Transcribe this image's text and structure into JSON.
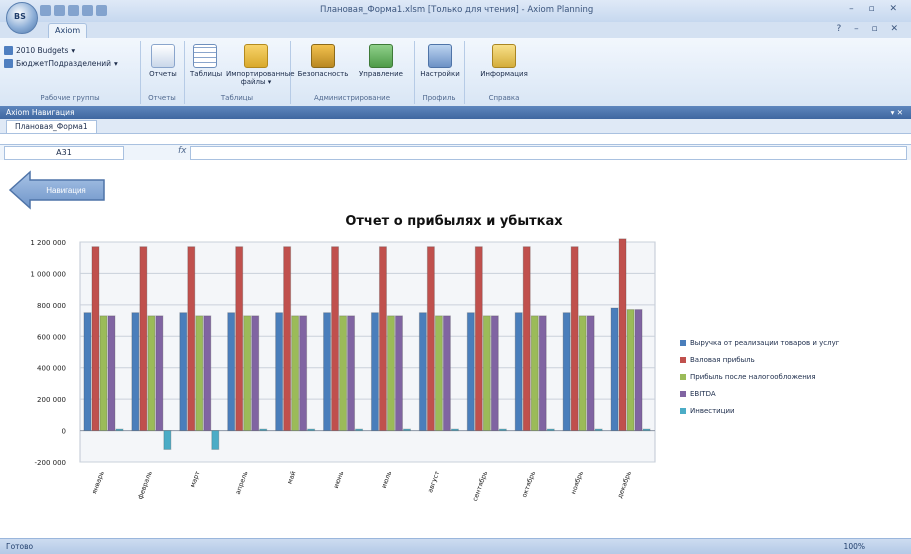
{
  "app": {
    "window_title": "Плановая_Форма1.xlsm [Только для чтения] - Axiom Planning",
    "orb_label": "BS",
    "active_tab": "Axiom"
  },
  "ribbon": {
    "groups": [
      {
        "label": "Рабочие группы",
        "items": [
          "2010 Budgets",
          "БюджетПодразделений"
        ]
      },
      {
        "label": "Отчеты",
        "buttons": [
          "Отчеты"
        ]
      },
      {
        "label": "Таблицы",
        "buttons": [
          "Таблицы",
          "Импортированные файлы"
        ]
      },
      {
        "label": "Администрирование",
        "buttons": [
          "Безопасность",
          "Управление"
        ]
      },
      {
        "label": "Профиль",
        "buttons": [
          "Настройки"
        ]
      },
      {
        "label": "Справка",
        "buttons": [
          "Информация"
        ]
      }
    ]
  },
  "nav": {
    "title": "Axiom Навигация",
    "sheet_tab": "Плановая_Форма1"
  },
  "formula": {
    "name_box": "A31",
    "fx": "fx"
  },
  "sheet": {
    "back_button_label": "Навигация"
  },
  "status": {
    "ready": "Готово",
    "zoom": "100%"
  },
  "colors": {
    "series1": "#4a7ebb",
    "series2": "#c0504d",
    "series3": "#9bbb59",
    "series4": "#8064a2",
    "series5": "#4bacc6"
  },
  "chart_data": {
    "type": "bar",
    "title": "Отчет о прибылях и убытках",
    "categories": [
      "январь",
      "февраль",
      "март",
      "апрель",
      "май",
      "июнь",
      "июль",
      "август",
      "сентябрь",
      "октябрь",
      "ноябрь",
      "декабрь"
    ],
    "ylim": [
      -200000,
      1200000
    ],
    "yticks": [
      -200000,
      0,
      200000,
      400000,
      600000,
      800000,
      1000000,
      1200000
    ],
    "ytick_labels": [
      "-200 000",
      "0",
      "200 000",
      "400 000",
      "600 000",
      "800 000",
      "1 000 000",
      "1 200 000"
    ],
    "grid": true,
    "legend_position": "right",
    "series": [
      {
        "name": "Выручка от реализации товаров и услуг",
        "values": [
          750000,
          750000,
          750000,
          750000,
          750000,
          750000,
          750000,
          750000,
          750000,
          750000,
          750000,
          780000
        ]
      },
      {
        "name": "Валовая прибыль",
        "values": [
          1170000,
          1170000,
          1170000,
          1170000,
          1170000,
          1170000,
          1170000,
          1170000,
          1170000,
          1170000,
          1170000,
          1220000
        ]
      },
      {
        "name": "Прибыль после налогообложения",
        "values": [
          730000,
          730000,
          730000,
          730000,
          730000,
          730000,
          730000,
          730000,
          730000,
          730000,
          730000,
          770000
        ]
      },
      {
        "name": "EBITDA",
        "values": [
          730000,
          730000,
          730000,
          730000,
          730000,
          730000,
          730000,
          730000,
          730000,
          730000,
          730000,
          770000
        ]
      },
      {
        "name": "Инвестиции",
        "values": [
          0,
          -120000,
          -120000,
          0,
          0,
          0,
          0,
          0,
          0,
          0,
          0,
          0
        ]
      }
    ]
  }
}
